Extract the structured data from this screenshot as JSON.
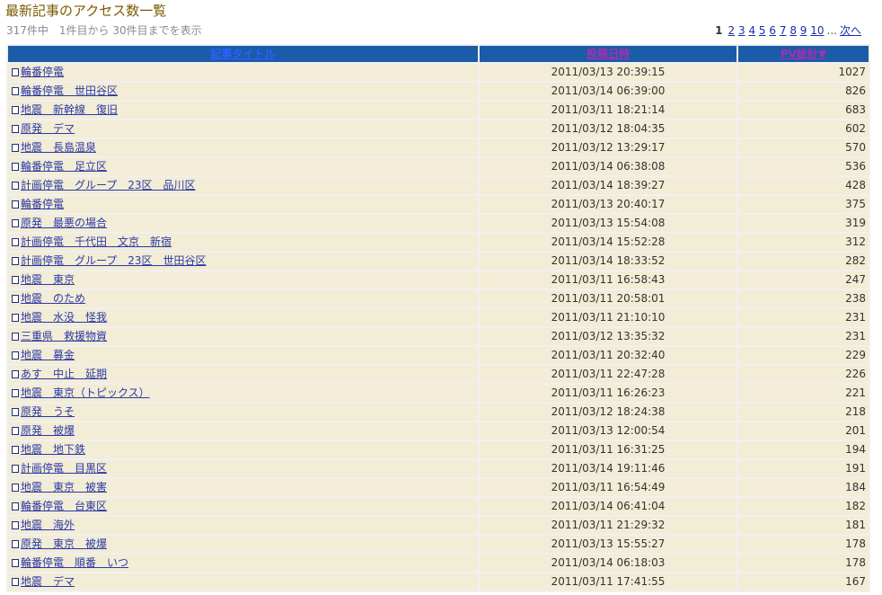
{
  "page": {
    "title": "最新記事のアクセス数一覧",
    "summary": "317件中　1件目から 30件目までを表示"
  },
  "pager": {
    "current": "1",
    "pages": [
      "2",
      "3",
      "4",
      "5",
      "6",
      "7",
      "8",
      "9",
      "10"
    ],
    "ellipsis": "...",
    "next": "次へ"
  },
  "table": {
    "headers": {
      "title": "記事タイトル",
      "date": "投稿日時",
      "pv": "PV総計▼"
    },
    "rows": [
      {
        "title": "輪番停電",
        "date": "2011/03/13 20:39:15",
        "pv": "1027"
      },
      {
        "title": "輪番停電　世田谷区",
        "date": "2011/03/14 06:39:00",
        "pv": "826"
      },
      {
        "title": "地震　新幹線　復旧",
        "date": "2011/03/11 18:21:14",
        "pv": "683"
      },
      {
        "title": "原発　デマ",
        "date": "2011/03/12 18:04:35",
        "pv": "602"
      },
      {
        "title": "地震　長島温泉",
        "date": "2011/03/12 13:29:17",
        "pv": "570"
      },
      {
        "title": "輪番停電　足立区",
        "date": "2011/03/14 06:38:08",
        "pv": "536"
      },
      {
        "title": "計画停電　グループ　23区　品川区",
        "date": "2011/03/14 18:39:27",
        "pv": "428"
      },
      {
        "title": "輪番停電",
        "date": "2011/03/13 20:40:17",
        "pv": "375"
      },
      {
        "title": "原発　最悪の場合",
        "date": "2011/03/13 15:54:08",
        "pv": "319"
      },
      {
        "title": "計画停電　千代田　文京　新宿",
        "date": "2011/03/14 15:52:28",
        "pv": "312"
      },
      {
        "title": "計画停電　グループ　23区　世田谷区",
        "date": "2011/03/14 18:33:52",
        "pv": "282"
      },
      {
        "title": "地震　東京",
        "date": "2011/03/11 16:58:43",
        "pv": "247"
      },
      {
        "title": "地震　のため",
        "date": "2011/03/11 20:58:01",
        "pv": "238"
      },
      {
        "title": "地震　水没　怪我",
        "date": "2011/03/11 21:10:10",
        "pv": "231"
      },
      {
        "title": "三重県　救援物資",
        "date": "2011/03/12 13:35:32",
        "pv": "231"
      },
      {
        "title": "地震　募金",
        "date": "2011/03/11 20:32:40",
        "pv": "229"
      },
      {
        "title": "あす　中止　延期",
        "date": "2011/03/11 22:47:28",
        "pv": "226"
      },
      {
        "title": "地震　東京（トピックス）",
        "date": "2011/03/11 16:26:23",
        "pv": "221"
      },
      {
        "title": "原発　うそ",
        "date": "2011/03/12 18:24:38",
        "pv": "218"
      },
      {
        "title": "原発　被爆",
        "date": "2011/03/13 12:00:54",
        "pv": "201"
      },
      {
        "title": "地震　地下鉄",
        "date": "2011/03/11 16:31:25",
        "pv": "194"
      },
      {
        "title": "計画停電　目黒区",
        "date": "2011/03/14 19:11:46",
        "pv": "191"
      },
      {
        "title": "地震　東京　被害",
        "date": "2011/03/11 16:54:49",
        "pv": "184"
      },
      {
        "title": "輪番停電　台東区",
        "date": "2011/03/14 06:41:04",
        "pv": "182"
      },
      {
        "title": "地震　海外",
        "date": "2011/03/11 21:29:32",
        "pv": "181"
      },
      {
        "title": "原発　東京　被爆",
        "date": "2011/03/13 15:55:27",
        "pv": "178"
      },
      {
        "title": "輪番停電　順番　いつ",
        "date": "2011/03/14 06:18:03",
        "pv": "178"
      },
      {
        "title": "地震　デマ",
        "date": "2011/03/11 17:41:55",
        "pv": "167"
      }
    ]
  }
}
